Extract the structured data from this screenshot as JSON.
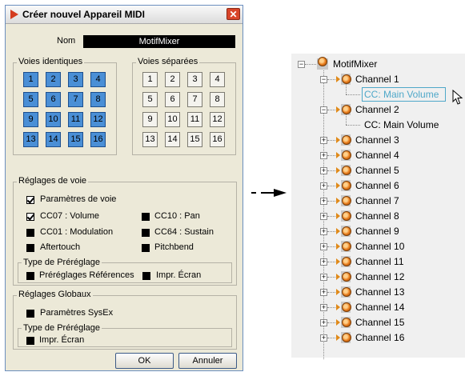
{
  "dialog": {
    "title": "Créer nouvel Appareil MIDI",
    "name_label": "Nom",
    "name_value": "MotifMixer",
    "identical_label": "Voies identiques",
    "separate_label": "Voies séparées",
    "identical_channels": [
      "1",
      "2",
      "3",
      "4",
      "5",
      "6",
      "7",
      "8",
      "9",
      "10",
      "11",
      "12",
      "13",
      "14",
      "15",
      "16"
    ],
    "separate_channels": [
      "1",
      "2",
      "3",
      "4",
      "5",
      "6",
      "7",
      "8",
      "9",
      "10",
      "11",
      "12",
      "13",
      "14",
      "15",
      "16"
    ],
    "channel_settings": {
      "label": "Réglages de voie",
      "channel_params": "Paramètres de voie",
      "cc07": "CC07 : Volume",
      "cc10": "CC10 : Pan",
      "cc01": "CC01 : Modulation",
      "cc64": "CC64 : Sustain",
      "aftertouch": "Aftertouch",
      "pitchbend": "Pitchbend",
      "preset_type_label": "Type de Préréglage",
      "preset_refs": "Préréglages Références",
      "print_screen": "Impr. Écran"
    },
    "global_settings": {
      "label": "Réglages Globaux",
      "sysex": "Paramètres SysEx",
      "preset_type_label": "Type de Préréglage",
      "print_screen": "Impr. Écran"
    },
    "ok_label": "OK",
    "cancel_label": "Annuler",
    "close_glyph": "✕"
  },
  "tree": {
    "root": "MotifMixer",
    "ch1": "Channel 1",
    "ch1_child": "CC: Main Volume",
    "ch2": "Channel 2",
    "ch2_child": "CC: Main Volume",
    "channels": [
      "Channel 3",
      "Channel 4",
      "Channel 5",
      "Channel 6",
      "Channel 7",
      "Channel 8",
      "Channel 9",
      "Channel 10",
      "Channel 11",
      "Channel 12",
      "Channel 13",
      "Channel 14",
      "Channel 15",
      "Channel 16"
    ]
  },
  "icons": {
    "app": "midi-device-icon",
    "node": "midi-node-icon",
    "cursor": "mouse-pointer-icon"
  },
  "colors": {
    "active_channel": "#4a8fd6",
    "selection": "#4fa8c9",
    "node": "#e77a1a"
  }
}
